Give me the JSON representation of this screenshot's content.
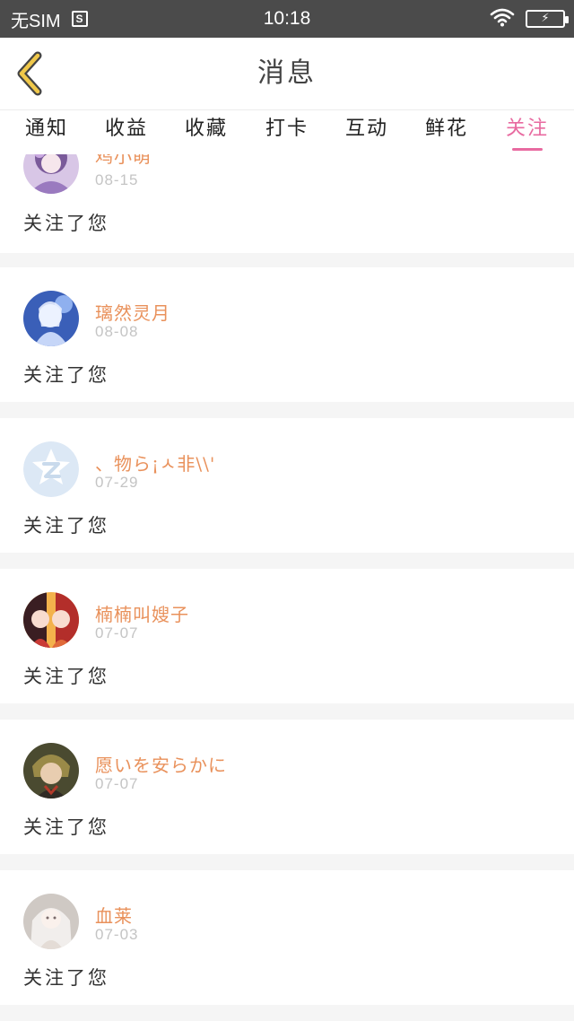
{
  "status_bar": {
    "carrier": "无SIM",
    "sim_icon_glyph": "S",
    "time": "10:18",
    "battery_glyph": "⚡",
    "icons": [
      "sim-card-icon",
      "wifi-icon",
      "battery-charging-icon"
    ]
  },
  "header": {
    "title": "消息",
    "back_icon": "chevron-left-icon",
    "accent": "#f0c84a"
  },
  "tabs": [
    {
      "label": "通知"
    },
    {
      "label": "收益"
    },
    {
      "label": "收藏"
    },
    {
      "label": "打卡"
    },
    {
      "label": "互动"
    },
    {
      "label": "鲜花"
    },
    {
      "label": "关注",
      "active": true
    }
  ],
  "colors": {
    "active_tab": "#e86aa0",
    "username": "#e9915b",
    "date": "#c4c4c4",
    "divider": "#f5f5f5"
  },
  "notifications": [
    {
      "name": "鸡小萌",
      "date": "08-15",
      "message": "关注了您",
      "avatar": "anime-girl-purple-avatar"
    },
    {
      "name": "璃然灵月",
      "date": "08-08",
      "message": "关注了您",
      "avatar": "anime-girl-blue-avatar"
    },
    {
      "name": "、物ら¡ㅅ非\\\\'",
      "date": "07-29",
      "message": "关注了您",
      "avatar": "default-z-avatar"
    },
    {
      "name": "楠楠叫嫂子",
      "date": "07-07",
      "message": "关注了您",
      "avatar": "anime-couple-red-avatar"
    },
    {
      "name": "愿いを安らかに",
      "date": "07-07",
      "message": "关注了您",
      "avatar": "anime-boy-avatar"
    },
    {
      "name": "血莱",
      "date": "07-03",
      "message": "关注了您",
      "avatar": "anime-girl-white-avatar"
    }
  ]
}
